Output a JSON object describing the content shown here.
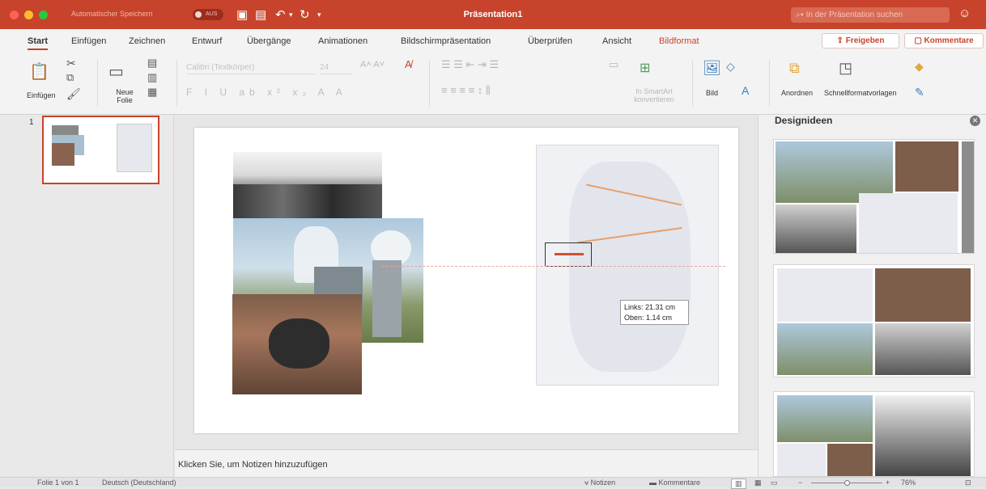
{
  "titlebar": {
    "autosave_label": "Automatischer Speichern",
    "autosave_state": "AUS",
    "document_title": "Präsentation1",
    "search_placeholder": "In der Präsentation suchen"
  },
  "tabs": [
    {
      "label": "Start",
      "active": true
    },
    {
      "label": "Einfügen"
    },
    {
      "label": "Zeichnen"
    },
    {
      "label": "Entwurf"
    },
    {
      "label": "Übergänge"
    },
    {
      "label": "Animationen"
    },
    {
      "label": "Bildschirmpräsentation"
    },
    {
      "label": "Überprüfen"
    },
    {
      "label": "Ansicht"
    },
    {
      "label": "Bildformat",
      "contextual": true
    }
  ],
  "share": {
    "share_label": "Freigeben",
    "comments_label": "Kommentare"
  },
  "ribbon": {
    "paste_label": "Einfügen",
    "new_slide_label": "Neue\nFolie",
    "font_name": "Calibri (Textkörper)",
    "font_size": "24",
    "smartart_label": "In SmartArt konvertieren",
    "picture_label": "Bild",
    "arrange_label": "Anordnen",
    "quickstyles_label": "Schnellformatvorlagen"
  },
  "slides_panel": {
    "slide_number": "1"
  },
  "tooltip": {
    "left": "Links: 21.31 cm",
    "top": "Oben: 1.14 cm"
  },
  "notes": {
    "placeholder": "Klicken Sie, um Notizen hinzuzufügen"
  },
  "design_pane": {
    "title": "Designideen"
  },
  "statusbar": {
    "slide_info": "Folie 1 von 1",
    "language": "Deutsch (Deutschland)",
    "notes_label": "Notizen",
    "comments_label": "Kommentare",
    "zoom": "76%"
  },
  "colors": {
    "accent": "#c8432b"
  }
}
